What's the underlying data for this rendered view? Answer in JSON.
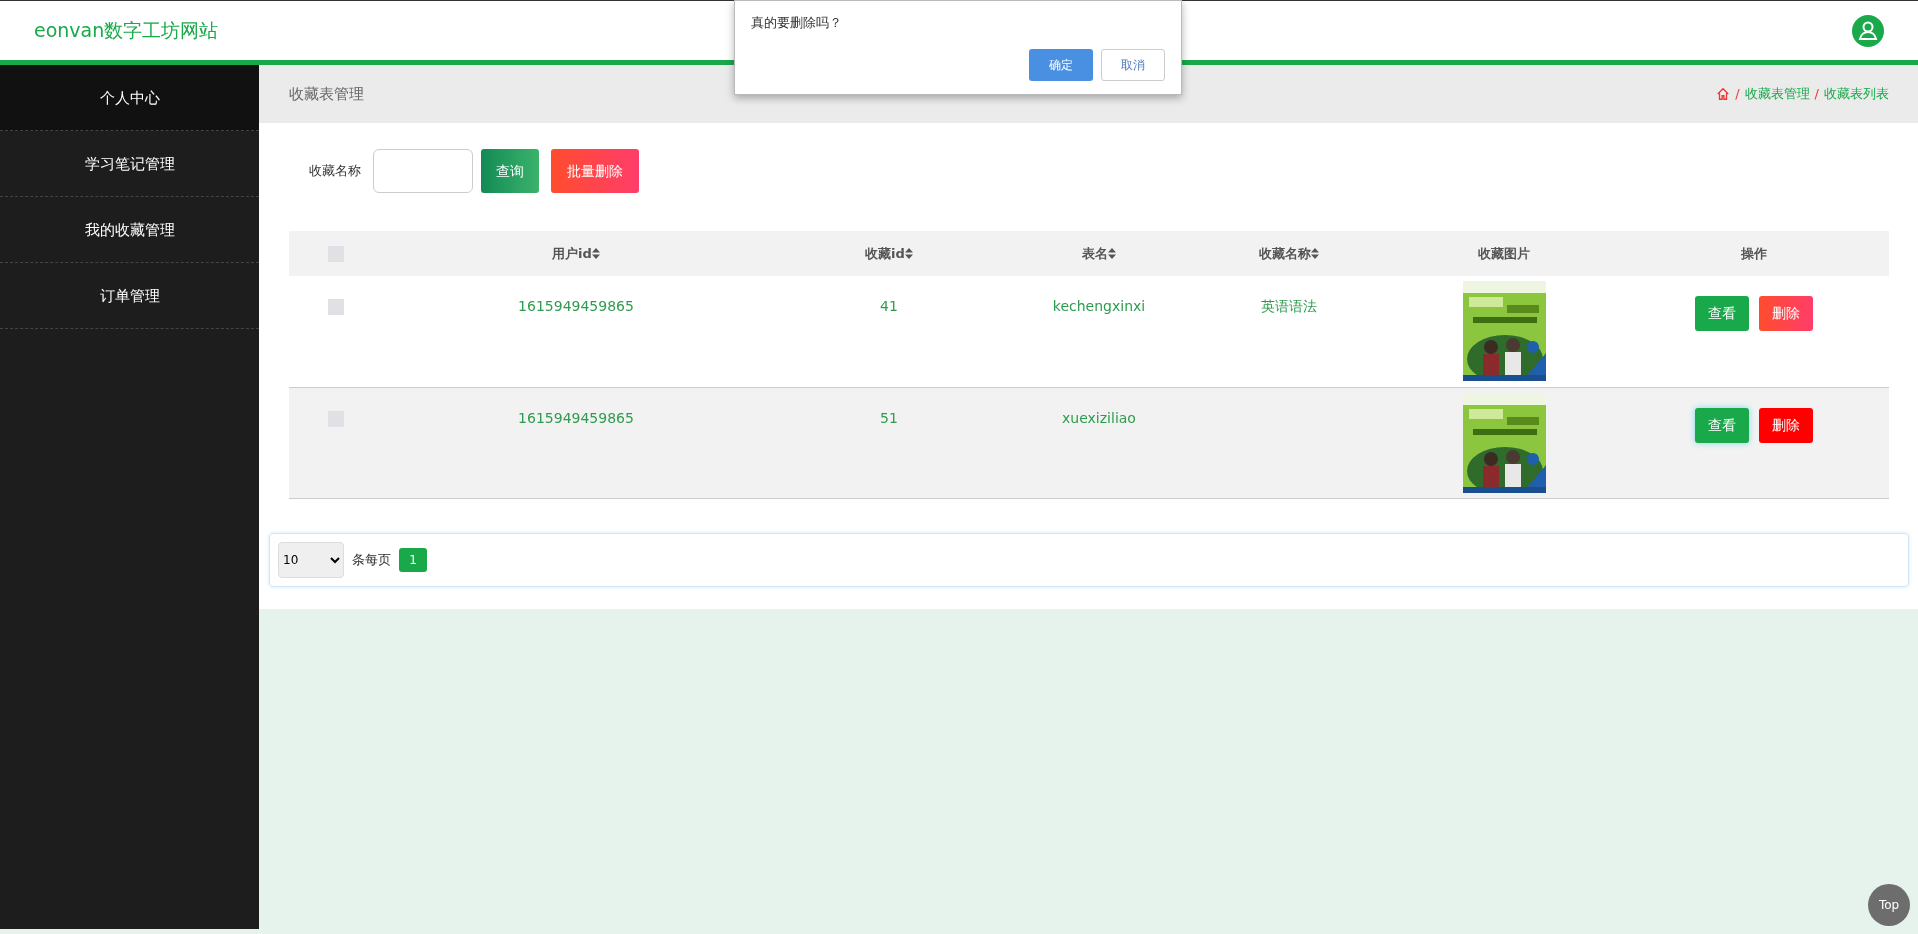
{
  "header": {
    "site_title": "eonvan数字工坊网站"
  },
  "dialog": {
    "message": "真的要删除吗？",
    "buttons": [
      {
        "label": "确定",
        "kind": "primary"
      },
      {
        "label": "取消",
        "kind": "secondary"
      }
    ]
  },
  "sidebar": {
    "items": [
      {
        "label": "个人中心",
        "selected": true
      },
      {
        "label": "学习笔记管理",
        "selected": false
      },
      {
        "label": "我的收藏管理",
        "selected": false
      },
      {
        "label": "订单管理",
        "selected": false
      }
    ]
  },
  "page_title": "收藏表管理",
  "breadcrumb": [
    {
      "separator": "/",
      "label": "收藏表管理"
    },
    {
      "separator": "/",
      "label": "收藏表列表"
    }
  ],
  "search": {
    "label": "收藏名称",
    "query_button": "查询",
    "batch_delete_button": "批量删除"
  },
  "table": {
    "select_all_checked": false,
    "columns": [
      {
        "label": "用户id",
        "sortable": true
      },
      {
        "label": "收藏id",
        "sortable": true
      },
      {
        "label": "表名",
        "sortable": true
      },
      {
        "label": "收藏名称",
        "sortable": true
      },
      {
        "label": "收藏图片",
        "sortable": false
      },
      {
        "label": "操作",
        "sortable": false
      }
    ],
    "rows": [
      {
        "checked": false,
        "user_id": "1615949459865",
        "fav_id": "41",
        "table_name": "kechengxinxi",
        "fav_name": "英语语法",
        "view": "查看",
        "delete": "删除",
        "hovered": false
      },
      {
        "checked": false,
        "user_id": "1615949459865",
        "fav_id": "51",
        "table_name": "xuexiziliao",
        "view": "查看",
        "delete": "删除",
        "hovered": true
      }
    ]
  },
  "pagination": {
    "page_size": "10",
    "per_page_label": "条每页",
    "pages": [
      {
        "label": "1",
        "selected": true
      }
    ]
  },
  "back_to_top": "Top"
}
